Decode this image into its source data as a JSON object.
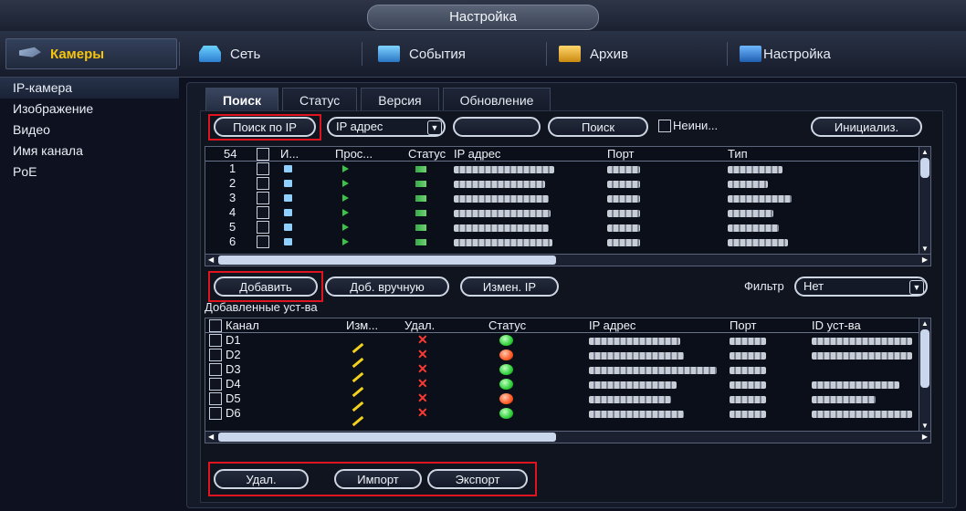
{
  "window": {
    "title": "Настройка"
  },
  "top_menu": {
    "items": [
      {
        "label": "Камеры",
        "icon": "camera-icon",
        "active": true
      },
      {
        "label": "Сеть",
        "icon": "network-icon"
      },
      {
        "label": "События",
        "icon": "events-icon"
      },
      {
        "label": "Архив",
        "icon": "archive-icon"
      },
      {
        "label": "Настройка",
        "icon": "settings-icon"
      }
    ]
  },
  "sidebar": {
    "items": [
      {
        "label": "IP-камера",
        "active": true
      },
      {
        "label": "Изображение"
      },
      {
        "label": "Видео"
      },
      {
        "label": "Имя канала"
      },
      {
        "label": "PoE"
      }
    ]
  },
  "tabs": [
    {
      "label": "Поиск",
      "active": true
    },
    {
      "label": "Статус"
    },
    {
      "label": "Версия"
    },
    {
      "label": "Обновление"
    }
  ],
  "toolbar": {
    "search_ip_label": "Поиск по IP",
    "filter_select_value": "IP адрес",
    "search_label": "Поиск",
    "uninit_label": "Неини...",
    "initialize_label": "Инициализ."
  },
  "found_table": {
    "count": "54",
    "headers": [
      "И...",
      "Прос...",
      "Статус",
      "IP адрес",
      "Порт",
      "Тип"
    ],
    "rows": [
      {
        "num": "1"
      },
      {
        "num": "2"
      },
      {
        "num": "3"
      },
      {
        "num": "4"
      },
      {
        "num": "5"
      },
      {
        "num": "6"
      }
    ]
  },
  "actions": {
    "add_label": "Добавить",
    "add_manual_label": "Доб. вручную",
    "change_ip_label": "Измен. IP",
    "filter_label": "Фильтр",
    "filter_value": "Нет"
  },
  "added_section": {
    "title": "Добавленные уст-ва"
  },
  "added_table": {
    "headers": [
      "Канал",
      "Изм...",
      "Удал.",
      "Статус",
      "IP адрес",
      "Порт",
      "ID уст-ва"
    ],
    "rows": [
      {
        "channel": "D1",
        "status": "green"
      },
      {
        "channel": "D2",
        "status": "red"
      },
      {
        "channel": "D3",
        "status": "green"
      },
      {
        "channel": "D4",
        "status": "green"
      },
      {
        "channel": "D5",
        "status": "red"
      },
      {
        "channel": "D6",
        "status": "green"
      }
    ]
  },
  "bottom": {
    "delete_label": "Удал.",
    "import_label": "Импорт",
    "export_label": "Экспорт"
  },
  "colors": {
    "accent": "#f6c40a",
    "highlight": "#e0141e",
    "status_ok": "#2fcf3a",
    "status_err": "#ff5a22"
  }
}
